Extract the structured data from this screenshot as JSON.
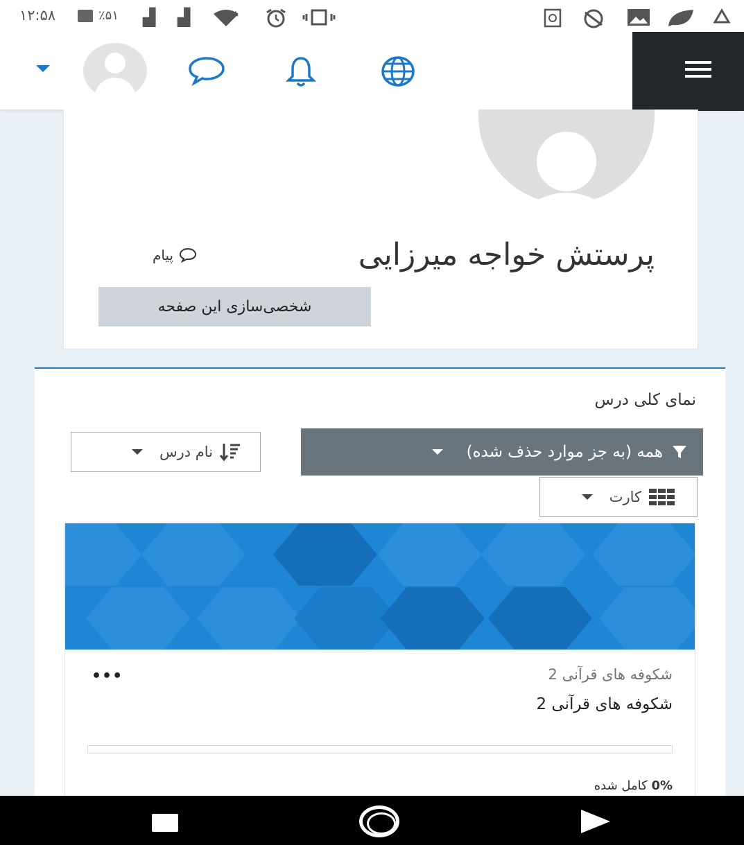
{
  "status_bar": {
    "time": "۱۲:۵۸",
    "battery": "٪۵۱",
    "icons": [
      "battery-icon",
      "signal-icon",
      "signal-icon",
      "wifi-icon",
      "alarm-icon",
      "vibrate-icon",
      "app-icon",
      "app-icon",
      "image-icon",
      "leaf-icon",
      "recycle-icon"
    ]
  },
  "navbar": {
    "icons": [
      "language-globe-icon",
      "notification-bell-icon",
      "messages-icon",
      "user-avatar",
      "user-menu-caret-icon",
      "hamburger-menu-icon"
    ],
    "accent_color": "#1e78c8"
  },
  "profile": {
    "name": "پرستش خواجه میرزایی",
    "message_label": "پیام",
    "customise_button": "شخصی‌سازی این صفحه"
  },
  "course_overview": {
    "title": "نمای کلی درس",
    "filter_label": "همه (به جز موارد حذف شده)",
    "sort_label": "نام درس",
    "view_label": "کارت",
    "course": {
      "category": "شکوفه های قرآنی 2",
      "name": "شکوفه های قرآنی 2",
      "menu": "•••",
      "progress_percent": 0,
      "progress_value": "0%",
      "progress_suffix": "کامل شده",
      "image_color": "#1f86d6"
    }
  },
  "system_nav": {
    "buttons": [
      "recents-square-icon",
      "home-circle-icon",
      "back-play-icon"
    ]
  }
}
